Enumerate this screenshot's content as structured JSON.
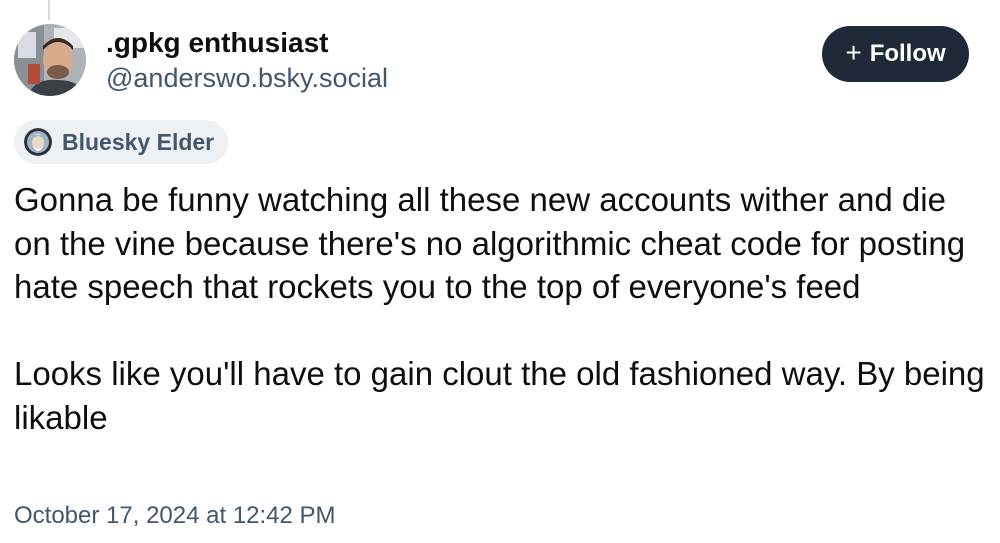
{
  "author": {
    "display_name": ".gpkg enthusiast",
    "handle": "@anderswo.bsky.social",
    "avatar_icon": "profile-photo"
  },
  "follow_button": {
    "icon": "plus-icon",
    "icon_glyph": "+",
    "label": "Follow"
  },
  "badge": {
    "icon": "bluesky-elder-icon",
    "label": "Bluesky Elder"
  },
  "post": {
    "paragraphs": [
      "Gonna be funny watching all these new accounts wither and die on the vine because there's no algorithmic cheat code for posting hate speech that rockets you to the top of everyone's feed",
      "Looks like you'll have to gain clout the old fashioned way. By being likable"
    ],
    "timestamp": "October 17, 2024 at 12:42 PM"
  },
  "colors": {
    "text_primary": "#0b0f14",
    "text_secondary": "#42576c",
    "button_bg": "#1f2937",
    "badge_bg": "#eef1f4"
  }
}
